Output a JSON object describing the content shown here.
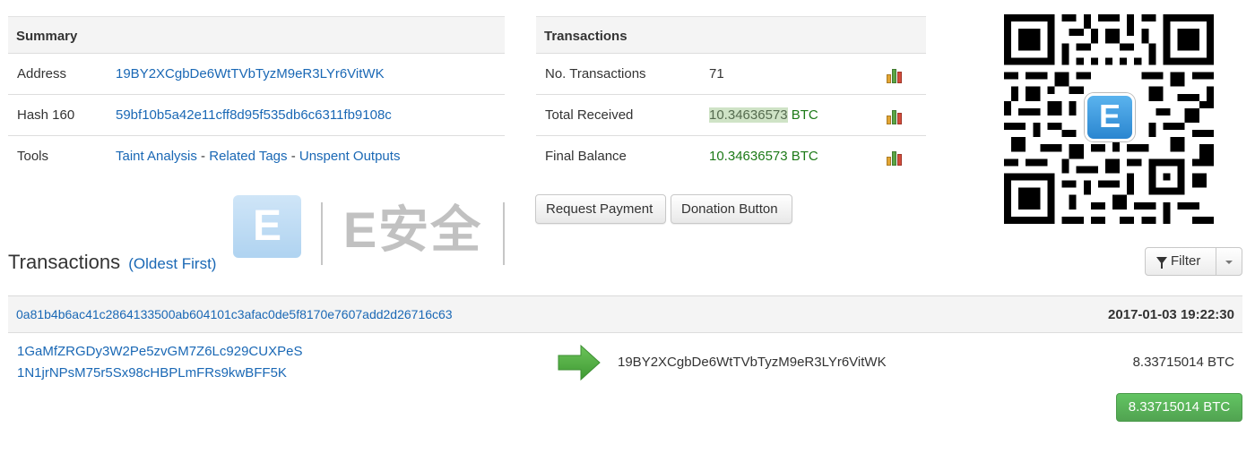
{
  "summary": {
    "header": "Summary",
    "address_label": "Address",
    "address_value": "19BY2XCgbDe6WtTVbTyzM9eR3LYr6VitWK",
    "hash160_label": "Hash 160",
    "hash160_value": "59bf10b5a42e11cff8d95f535db6c6311fb9108c",
    "tools_label": "Tools",
    "tools": [
      "Taint Analysis",
      "Related Tags",
      "Unspent Outputs"
    ],
    "tools_separator": " - "
  },
  "stats": {
    "header": "Transactions",
    "rows": [
      {
        "label": "No. Transactions",
        "value": "71",
        "unit": ""
      },
      {
        "label": "Total Received",
        "value": "10.34636573",
        "unit": "BTC"
      },
      {
        "label": "Final Balance",
        "value": "10.34636573",
        "unit": "BTC"
      }
    ],
    "request_button": "Request Payment",
    "donation_button": "Donation Button"
  },
  "watermark": {
    "icon_letter": "E",
    "text": "E安全"
  },
  "qr_badge_letter": "E",
  "transactions": {
    "title": "Transactions",
    "order_label": "(Oldest First)",
    "filter_label": "Filter",
    "items": [
      {
        "hash": "0a81b4b6ac41c2864133500ab604101c3afac0de5f8170e7607add2d26716c63",
        "date": "2017-01-03 19:22:30",
        "inputs": [
          "1GaMfZRGDy3W2Pe5zvGM7Z6Lc929CUXPeS",
          "1N1jrNPsM75r5Sx98cHBPLmFRs9kwBFF5K"
        ],
        "output_address": "19BY2XCgbDe6WtTVbTyzM9eR3LYr6VitWK",
        "output_amount": "8.33715014 BTC",
        "total": "8.33715014 BTC"
      }
    ]
  },
  "colors": {
    "link": "#1a68b5",
    "balance_green": "#1d7a18",
    "total_button": "#5cb85c",
    "arrow_green": "#4cae3c"
  },
  "icons": [
    "chart-icon",
    "filter-icon",
    "caret-down-icon",
    "right-arrow-icon",
    "qr-code"
  ]
}
